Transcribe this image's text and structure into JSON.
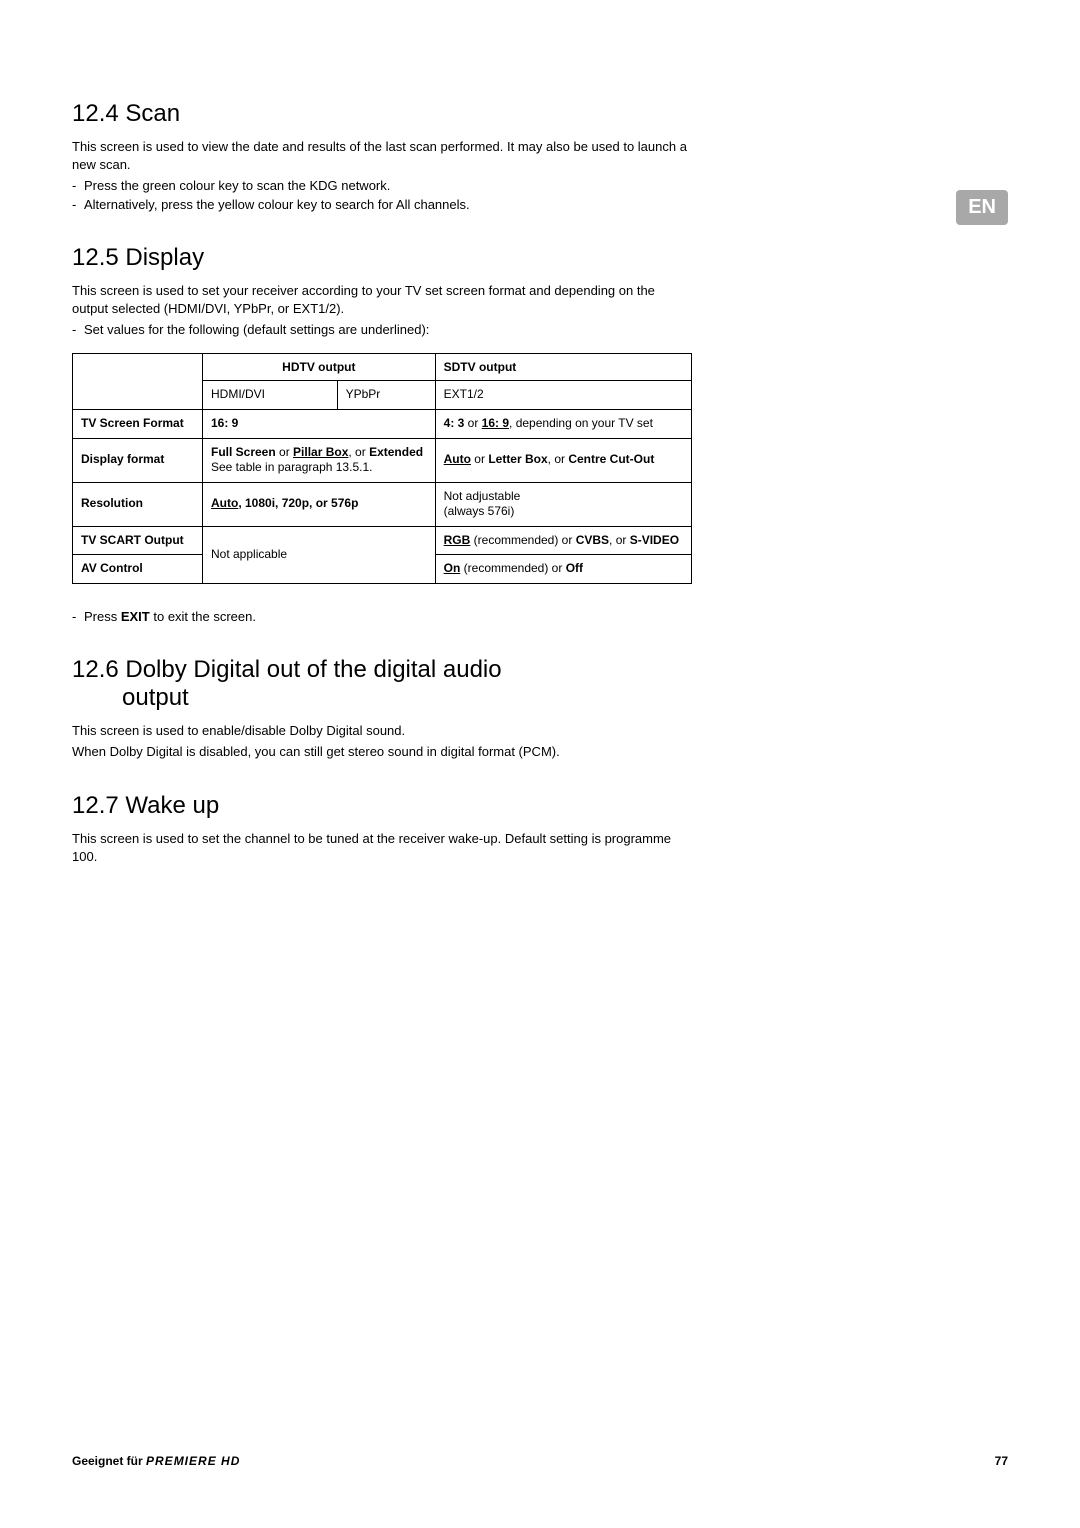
{
  "lang_label": "EN",
  "sections": {
    "scan": {
      "heading": "12.4 Scan",
      "p1": "This screen is used to view the date and results of the last scan performed. It may also be used to launch a new scan.",
      "b1": "Press the green colour key to scan the KDG network.",
      "b2": "Alternatively, press the yellow colour key to search for All channels."
    },
    "display": {
      "heading": "12.5 Display",
      "p1": "This screen is used to set your receiver according to your TV set screen format and depending on the output selected (HDMI/DVI, YPbPr, or EXT1/2).",
      "b1": "Set values for the following (default settings are underlined):",
      "table": {
        "hdtv_header": "HDTV output",
        "sdtv_header": "SDTV output",
        "hdmi_dvi": "HDMI/DVI",
        "ypbpr": "YPbPr",
        "ext12": "EXT1/2",
        "rows": {
          "tv_screen_format": {
            "label": "TV Screen Format",
            "hdtv": "16: 9",
            "sdtv_prefix": "4: 3",
            "sdtv_or": " or ",
            "sdtv_u": "16: 9",
            "sdtv_suffix": ", depending on your TV set"
          },
          "display_format": {
            "label": "Display format",
            "hdtv_b1": "Full Screen",
            "hdtv_or1": " or ",
            "hdtv_u": "Pillar Box",
            "hdtv_or2": ", or ",
            "hdtv_b2": "Extended",
            "hdtv_line2": "See table in paragraph 13.5.1.",
            "sdtv_u": "Auto",
            "sdtv_or": " or ",
            "sdtv_b1": "Letter Box",
            "sdtv_or2": ", or ",
            "sdtv_b2": "Centre Cut-Out"
          },
          "resolution": {
            "label": "Resolution",
            "hdtv_u": "Auto",
            "hdtv_rest": ", 1080i, 720p, or 576p",
            "sdtv_l1": "Not adjustable",
            "sdtv_l2": "(always 576i)"
          },
          "tv_scart": {
            "label": "TV SCART Output",
            "hdtv_shared": "Not applicable",
            "sdtv_u": "RGB",
            "sdtv_rec": " (recommended) or ",
            "sdtv_b1": "CVBS",
            "sdtv_or": ", or ",
            "sdtv_b2": "S-VIDEO"
          },
          "av_control": {
            "label": "AV Control",
            "sdtv_u": "On",
            "sdtv_rec": " (recommended) or ",
            "sdtv_b": "Off"
          }
        }
      },
      "exit_prefix": "Press ",
      "exit_b": "EXIT",
      "exit_suffix": " to exit the screen."
    },
    "dolby": {
      "heading_l1": "12.6 Dolby Digital out of the digital audio",
      "heading_l2": "output",
      "p1": "This screen is used to enable/disable Dolby Digital sound.",
      "p2": "When Dolby Digital is disabled, you can still get stereo sound in digital format (PCM)."
    },
    "wakeup": {
      "heading": "12.7 Wake up",
      "p1": "This screen is used to set the channel to be tuned at the receiver wake-up. Default setting is programme 100."
    }
  },
  "footer": {
    "left_prefix": "Geeignet für ",
    "left_brand": "PREMIERE HD",
    "page": "77"
  }
}
